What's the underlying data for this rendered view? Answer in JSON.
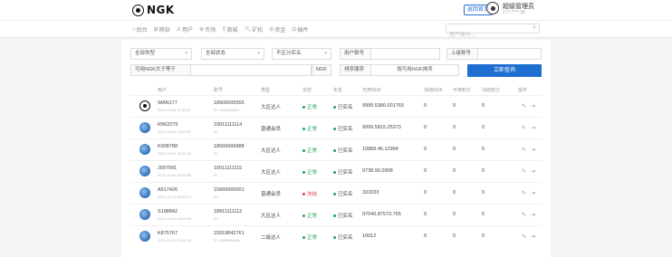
{
  "header": {
    "logo_text": "NGK",
    "back_button": "返回首页",
    "user_name": "超级管理员",
    "user_phone": "177-****-98"
  },
  "nav": {
    "items": [
      {
        "icon": "home-icon",
        "glyph": "⌂",
        "label": "后台"
      },
      {
        "icon": "grid-icon",
        "glyph": "⊞",
        "label": "网站"
      },
      {
        "icon": "users-icon",
        "glyph": "♙",
        "label": "用户"
      },
      {
        "icon": "globe-icon",
        "glyph": "⊕",
        "label": "币场"
      },
      {
        "icon": "cart-icon",
        "glyph": "⊽",
        "label": "商城"
      },
      {
        "icon": "pickaxe-icon",
        "glyph": "⛏",
        "label": "矿机"
      },
      {
        "icon": "wallet-icon",
        "glyph": "⊜",
        "label": "资金"
      },
      {
        "icon": "plugin-icon",
        "glyph": "⊡",
        "label": "插件"
      }
    ],
    "search_placeholder": "用户账号..."
  },
  "filters": {
    "type": "全部类型",
    "status": "全部状态",
    "region": "不区分实名",
    "account_label": "用户账号",
    "parent_label": "上级账号",
    "ngk_threshold": "可用NGK大于等于",
    "ngk_suffix": "NGK",
    "sort_label": "排序顺序",
    "sort_value": "按可用NGK排序",
    "submit": "立即查询"
  },
  "table": {
    "headers": [
      "用户",
      "账号",
      "类型",
      "状态",
      "实名",
      "可用NGK",
      "冻结NGK",
      "可用积分",
      "冻结积分",
      "操作"
    ],
    "rows": [
      {
        "avatar": "logo",
        "name": "WAN177",
        "date": "2021-10-06 10:34:07",
        "account": "18900005555",
        "account_sub": "ID: 1008600001",
        "type": "大区达人",
        "status": "正常",
        "status_color": "#1fa35b",
        "verified": "已实名",
        "verified_color": "#1fa35b",
        "ngk": "9999.5380.001765",
        "frozen_ngk": "0",
        "points": "0",
        "frozen_points": "0"
      },
      {
        "avatar": "globe",
        "name": "R962279",
        "date": "2021-04-25 16:00:57",
        "account": "10011111114",
        "account_sub": "ID:",
        "type": "普通会员",
        "status": "正常",
        "status_color": "#1fa35b",
        "verified": "已实名",
        "verified_color": "#1fa35b",
        "ngk": "9999.5815.25373",
        "frozen_ngk": "0",
        "points": "0",
        "frozen_points": "0"
      },
      {
        "avatar": "globe",
        "name": "K908788",
        "date": "2021-04-24 20:27:10",
        "account": "18666666888",
        "account_sub": "ID:",
        "type": "大区达人",
        "status": "正常",
        "status_color": "#1fa35b",
        "verified": "已实名",
        "verified_color": "#1fa35b",
        "ngk": "10889.46.12994",
        "frozen_ngk": "0",
        "points": "0",
        "frozen_points": "0"
      },
      {
        "avatar": "globe",
        "name": "J007991",
        "date": "2021-04-25 16:00:55",
        "account": "10011111115",
        "account_sub": "ID:",
        "type": "大区达人",
        "status": "正常",
        "status_color": "#1fa35b",
        "verified": "已实名",
        "verified_color": "#1fa35b",
        "ngk": "9738.90.0908",
        "frozen_ngk": "0",
        "points": "0",
        "frozen_points": "0"
      },
      {
        "avatar": "globe",
        "name": "A517426",
        "date": "2021-10-15 08:30:17",
        "account": "15666660001",
        "account_sub": "ID:",
        "type": "普通会员",
        "status": "冻结",
        "status_color": "#e04646",
        "verified": "已实名",
        "verified_color": "#1fa35b",
        "ngk": "333333",
        "frozen_ngk": "0",
        "points": "0",
        "frozen_points": "0"
      },
      {
        "avatar": "globe",
        "name": "S198842",
        "date": "2021-04-25 16:00:55",
        "account": "18811111112",
        "account_sub": "ID:",
        "type": "大区达人",
        "status": "正常",
        "status_color": "#1fa35b",
        "verified": "已实名",
        "verified_color": "#1fa35b",
        "ngk": "97040.87573.765",
        "frozen_ngk": "0",
        "points": "0",
        "frozen_points": "0"
      },
      {
        "avatar": "globe",
        "name": "K875767",
        "date": "2021-10-20 13:09:49",
        "account": "15918842761",
        "account_sub": "ID: 1008600006",
        "type": "二级达人",
        "status": "正常",
        "status_color": "#1fa35b",
        "verified": "已实名",
        "verified_color": "#1fa35b",
        "ngk": "10012",
        "frozen_ngk": "0",
        "points": "0",
        "frozen_points": "0"
      }
    ]
  }
}
